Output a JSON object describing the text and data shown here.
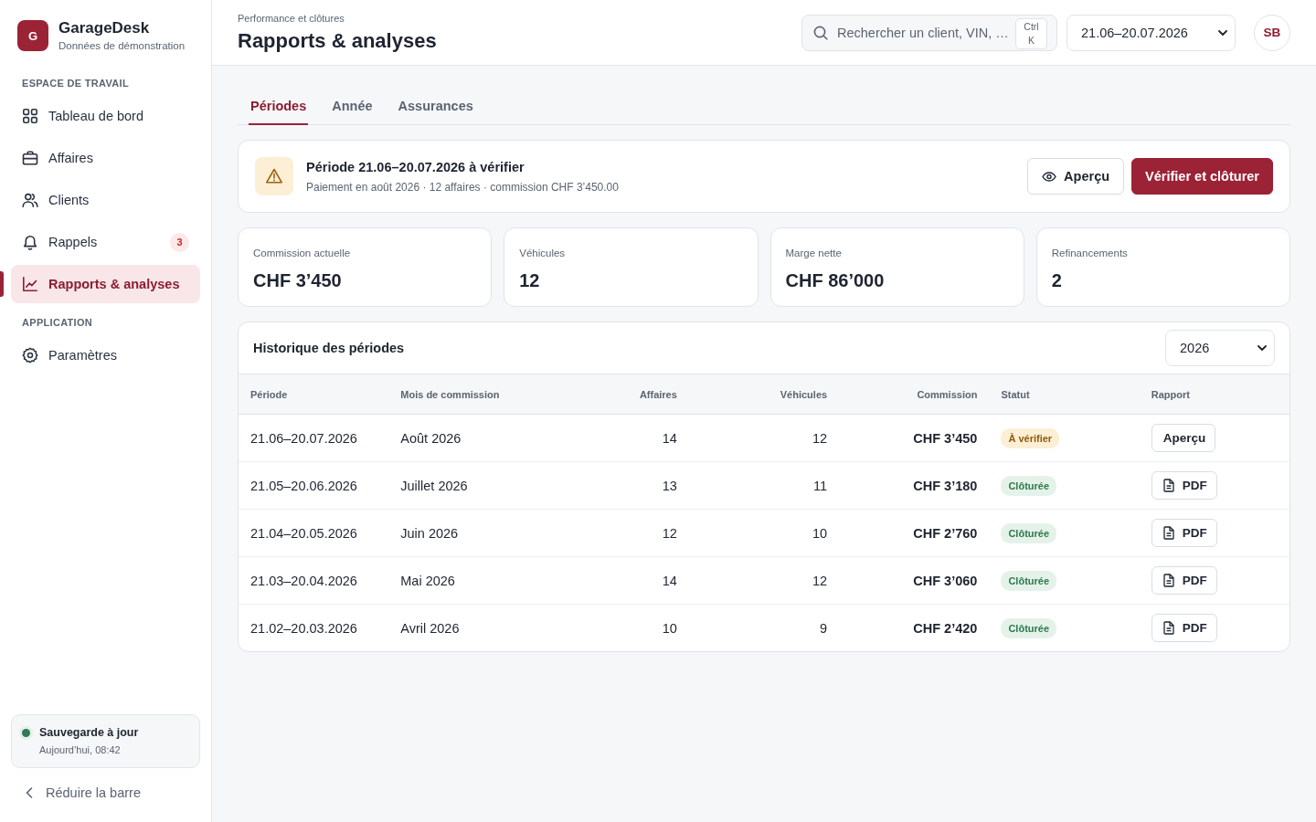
{
  "sidebar": {
    "brand": {
      "logo": "G",
      "name": "GarageDesk",
      "subtitle": "Données de démonstration"
    },
    "sections": [
      {
        "heading": "ESPACE DE TRAVAIL",
        "items": [
          {
            "label": "Tableau de bord",
            "selected": false
          },
          {
            "label": "Affaires",
            "selected": false
          },
          {
            "label": "Clients",
            "selected": false
          },
          {
            "label": "Rappels",
            "selected": false,
            "badge": "3"
          },
          {
            "label": "Rapports & analyses",
            "selected": true
          }
        ]
      },
      {
        "heading": "APPLICATION",
        "items": [
          {
            "label": "Paramètres",
            "selected": false
          }
        ]
      }
    ],
    "backup_status": {
      "title": "Sauvegarde à jour",
      "time": "Aujourd’hui, 08:42"
    },
    "collapse_button": {
      "label": "Réduire la barre"
    }
  },
  "header": {
    "breadcrumb": "Performance et clôtures",
    "title": "Rapports & analyses",
    "search": {
      "placeholder": "Rechercher un client, VIN, …",
      "shortcut": "Ctrl K"
    },
    "period_select": {
      "value": "21.06–20.07.2026"
    },
    "avatar": "SB"
  },
  "tabs": [
    {
      "label": "Périodes",
      "selected": true
    },
    {
      "label": "Année",
      "selected": false
    },
    {
      "label": "Assurances",
      "selected": false
    }
  ],
  "alert": {
    "title": "Période 21.06–20.07.2026 à vérifier",
    "details": "Paiement en août 2026 · 12 affaires · commission CHF 3’450.00",
    "buttons": [
      {
        "label": "Aperçu",
        "kind": "secondary"
      },
      {
        "label": "Vérifier et clôturer",
        "kind": "primary"
      }
    ]
  },
  "stats": [
    {
      "label": "Commission actuelle",
      "value": "CHF 3’450"
    },
    {
      "label": "Véhicules",
      "value": "12"
    },
    {
      "label": "Marge nette",
      "value": "CHF 86’000"
    },
    {
      "label": "Refinancements",
      "value": "2"
    }
  ],
  "history": {
    "title": "Historique des périodes",
    "year_select": {
      "value": "2026"
    },
    "table": {
      "columns": [
        "Période",
        "Mois de commission",
        "Affaires",
        "Véhicules",
        "Commission",
        "Statut",
        "Rapport"
      ],
      "rows": [
        {
          "period": "21.06–20.07.2026",
          "month": "Août 2026",
          "deals": "14",
          "vehicles": "12",
          "commission": "CHF 3’450",
          "status": {
            "label": "À vérifier",
            "kind": "pending"
          },
          "report": {
            "label": "Aperçu",
            "kind": "preview"
          }
        },
        {
          "period": "21.05–20.06.2026",
          "month": "Juillet 2026",
          "deals": "13",
          "vehicles": "11",
          "commission": "CHF 3’180",
          "status": {
            "label": "Clôturée",
            "kind": "closed"
          },
          "report": {
            "label": "PDF",
            "kind": "pdf"
          }
        },
        {
          "period": "21.04–20.05.2026",
          "month": "Juin 2026",
          "deals": "12",
          "vehicles": "10",
          "commission": "CHF 2’760",
          "status": {
            "label": "Clôturée",
            "kind": "closed"
          },
          "report": {
            "label": "PDF",
            "kind": "pdf"
          }
        },
        {
          "period": "21.03–20.04.2026",
          "month": "Mai 2026",
          "deals": "14",
          "vehicles": "12",
          "commission": "CHF 3’060",
          "status": {
            "label": "Clôturée",
            "kind": "closed"
          },
          "report": {
            "label": "PDF",
            "kind": "pdf"
          }
        },
        {
          "period": "21.02–20.03.2026",
          "month": "Avril 2026",
          "deals": "10",
          "vehicles": "9",
          "commission": "CHF 2’420",
          "status": {
            "label": "Clôturée",
            "kind": "closed"
          },
          "report": {
            "label": "PDF",
            "kind": "pdf"
          }
        }
      ]
    }
  }
}
